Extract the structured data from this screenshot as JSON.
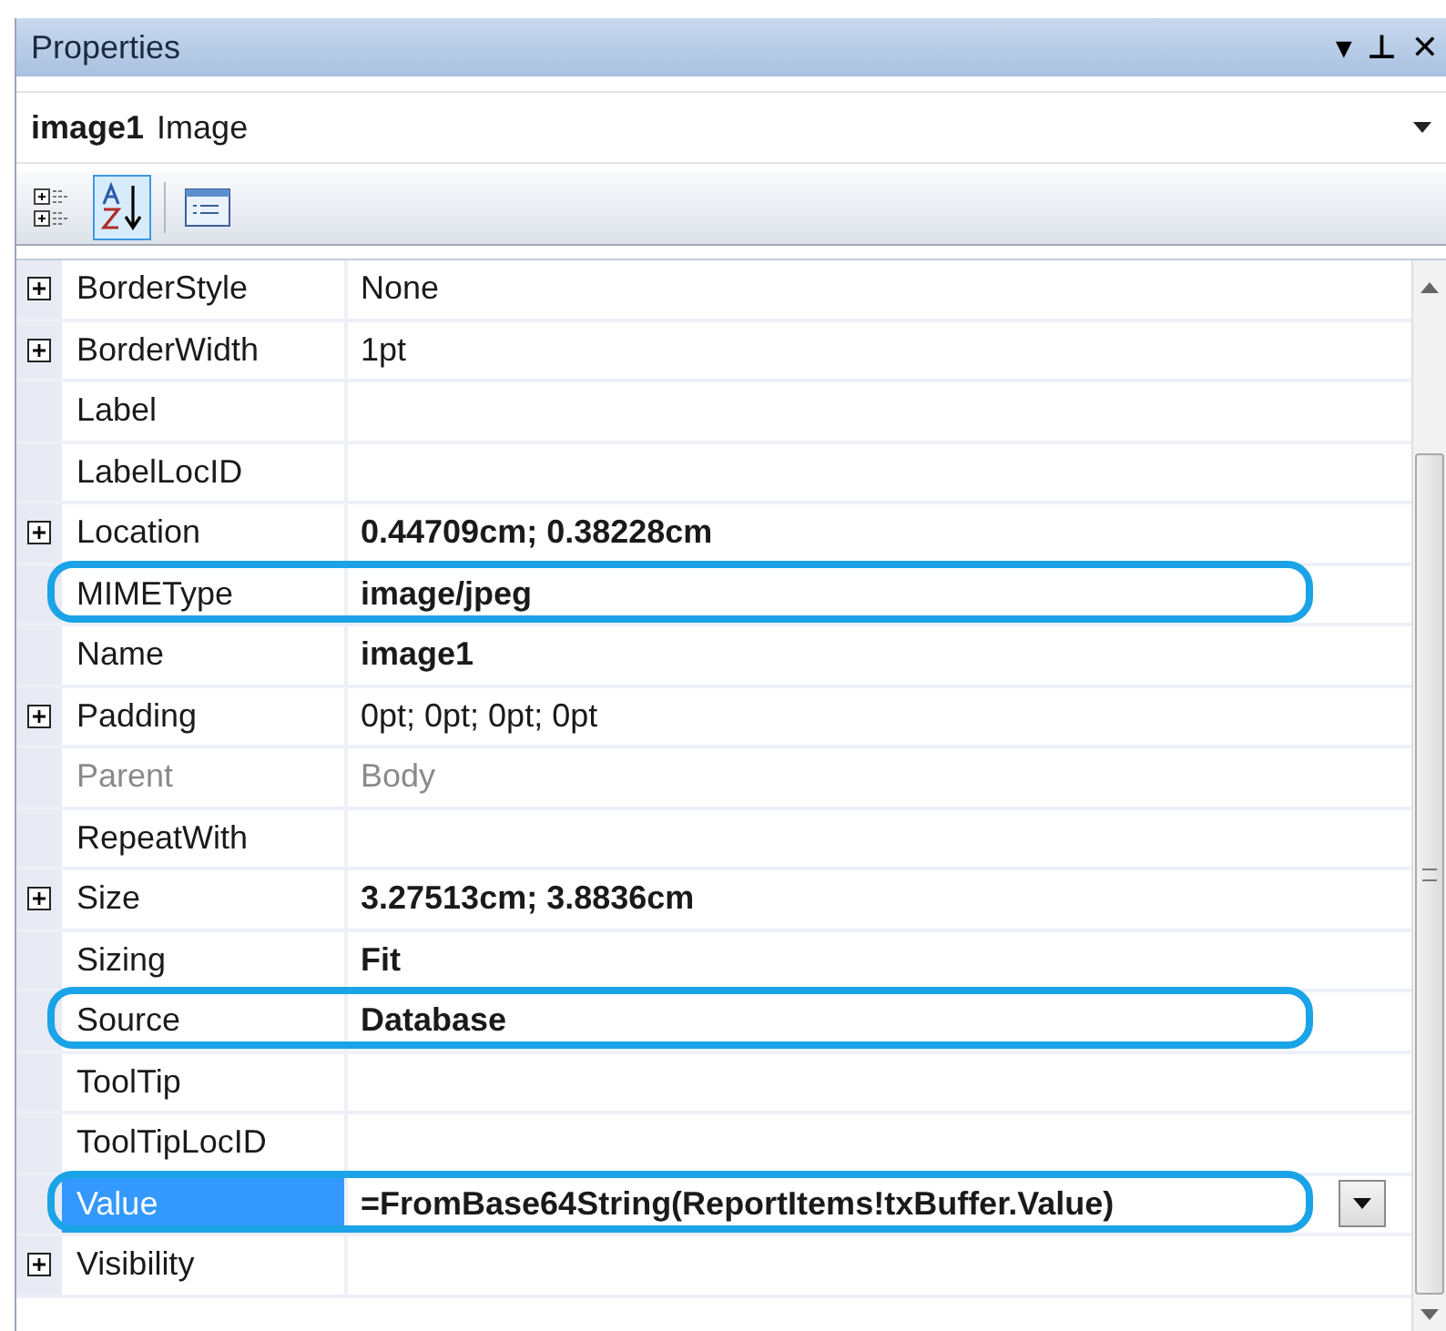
{
  "window": {
    "title": "Properties",
    "buttons": [
      "▾",
      "⊥",
      "✕"
    ]
  },
  "object_selector": {
    "name": "image1",
    "type": "Image"
  },
  "toolbar": [
    {
      "kind": "categorized",
      "selected": false
    },
    {
      "kind": "alphabetical",
      "selected": true
    },
    {
      "kind": "pages",
      "selected": false
    }
  ],
  "rows": [
    {
      "name": "BorderStyle",
      "value": "None",
      "expandable": true,
      "bold": false,
      "disabled": false,
      "selected": false,
      "circled": false
    },
    {
      "name": "BorderWidth",
      "value": "1pt",
      "expandable": true,
      "bold": false,
      "disabled": false,
      "selected": false,
      "circled": false
    },
    {
      "name": "Label",
      "expandable": false,
      "disabled": false,
      "selected": false,
      "circled": false
    },
    {
      "name": "LabelLocID",
      "expandable": false,
      "disabled": false,
      "selected": false,
      "circled": false
    },
    {
      "name": "Location",
      "value": "0.44709cm; 0.38228cm",
      "expandable": true,
      "bold": true,
      "disabled": false,
      "selected": false,
      "circled": false
    },
    {
      "name": "MIMEType",
      "value": "image/jpeg",
      "expandable": false,
      "bold": true,
      "disabled": false,
      "selected": false,
      "circled": true
    },
    {
      "name": "Name",
      "value": "image1",
      "expandable": false,
      "bold": true,
      "disabled": false,
      "selected": false,
      "circled": false
    },
    {
      "name": "Padding",
      "value": "0pt; 0pt; 0pt; 0pt",
      "expandable": true,
      "bold": false,
      "disabled": false,
      "selected": false,
      "circled": false
    },
    {
      "name": "Parent",
      "value": "Body",
      "expandable": false,
      "bold": false,
      "disabled": true,
      "selected": false,
      "circled": false
    },
    {
      "name": "RepeatWith",
      "expandable": false,
      "disabled": false,
      "selected": false,
      "circled": false
    },
    {
      "name": "Size",
      "value": "3.27513cm; 3.8836cm",
      "expandable": true,
      "bold": true,
      "disabled": false,
      "selected": false,
      "circled": false
    },
    {
      "name": "Sizing",
      "value": "Fit",
      "expandable": false,
      "bold": true,
      "disabled": false,
      "selected": false,
      "circled": false
    },
    {
      "name": "Source",
      "value": "Database",
      "expandable": false,
      "bold": true,
      "disabled": false,
      "selected": false,
      "circled": true
    },
    {
      "name": "ToolTip",
      "expandable": false,
      "disabled": false,
      "selected": false,
      "circled": false
    },
    {
      "name": "ToolTipLocID",
      "expandable": false,
      "disabled": false,
      "selected": false,
      "circled": false
    },
    {
      "name": "Value",
      "value": "=FromBase64String(ReportItems!txBuffer.Value)",
      "expandable": false,
      "bold": true,
      "disabled": false,
      "selected": true,
      "circled": true
    },
    {
      "name": "Visibility",
      "expandable": true,
      "disabled": false,
      "selected": false,
      "circled": false
    }
  ]
}
